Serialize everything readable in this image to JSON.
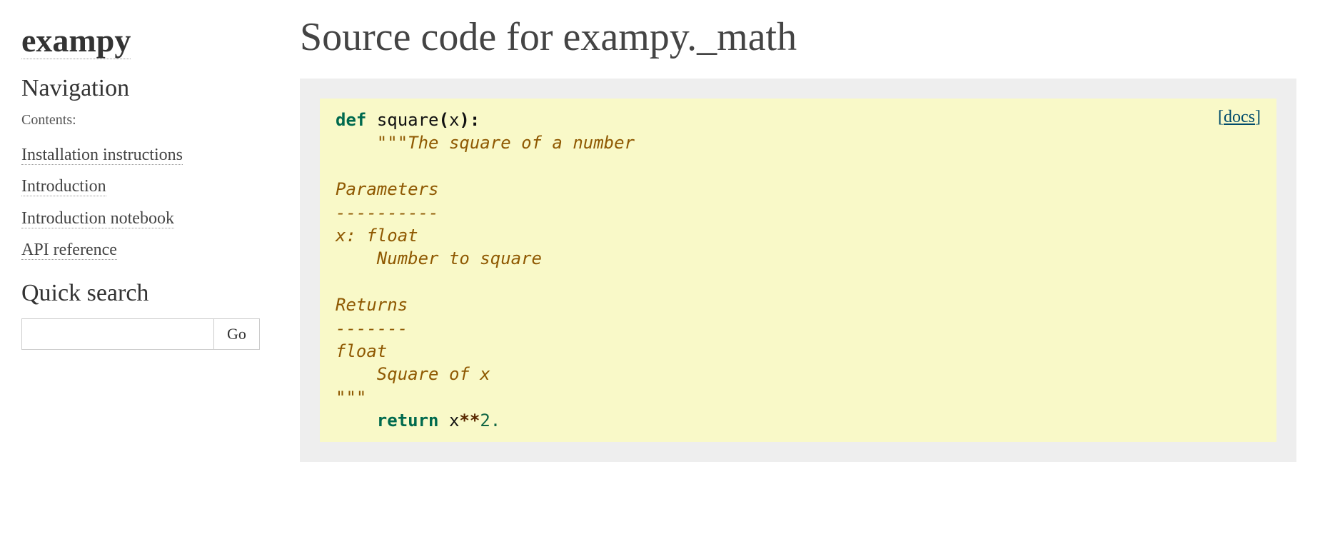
{
  "sidebar": {
    "logo": "exampy",
    "nav_heading": "Navigation",
    "contents_caption": "Contents:",
    "items": [
      {
        "label": "Installation instructions"
      },
      {
        "label": "Introduction"
      },
      {
        "label": "Introduction notebook"
      },
      {
        "label": "API reference"
      }
    ],
    "search_heading": "Quick search",
    "search_value": "",
    "go_label": "Go"
  },
  "main": {
    "title": "Source code for exampy._math",
    "docs_link_label": "docs",
    "code": {
      "kw_def": "def",
      "func_name": "square",
      "p_open": "(",
      "param": "x",
      "p_close_colon": "):",
      "docstring_l1": "    \"\"\"The square of a number",
      "docstring_l2": "",
      "docstring_l3": "Parameters",
      "docstring_l4": "----------",
      "docstring_l5": "x: float",
      "docstring_l6": "    Number to square",
      "docstring_l7": "",
      "docstring_l8": "Returns",
      "docstring_l9": "-------",
      "docstring_l10": "float",
      "docstring_l11": "    Square of x",
      "docstring_l12": "\"\"\"",
      "kw_return": "return",
      "ret_name": "x",
      "ret_op": "**",
      "ret_num": "2."
    }
  }
}
